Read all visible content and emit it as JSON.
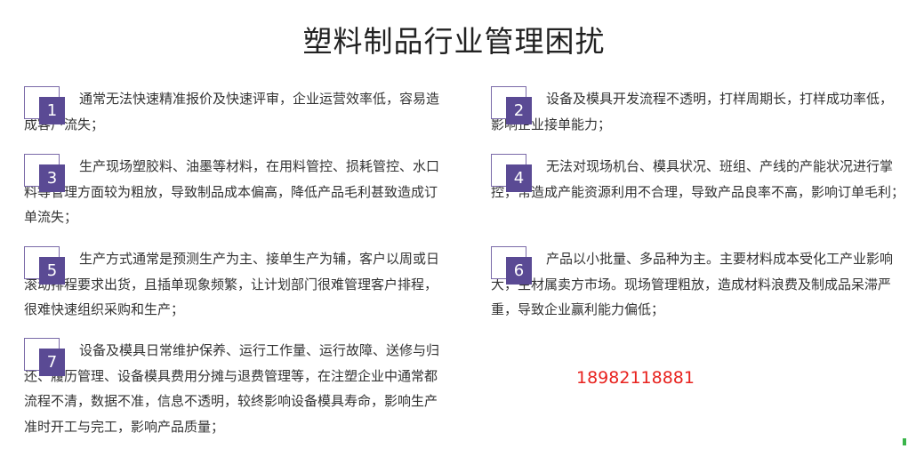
{
  "title": "塑料制品行业管理困扰",
  "items": [
    {
      "num": "1",
      "text": "通常无法快速精准报价及快速评审，企业运营效率低，容易造成客户流失；"
    },
    {
      "num": "2",
      "text": "设备及模具开发流程不透明，打样周期长，打样成功率低，影响企业接单能力；"
    },
    {
      "num": "3",
      "text": "生产现场塑胶料、油墨等材料，在用料管控、损耗管控、水口料等管理方面较为粗放，导致制品成本偏高，降低产品毛利甚致造成订单流失；"
    },
    {
      "num": "4",
      "text": "无法对现场机台、模具状况、班组、产线的产能状况进行掌控，常造成产能资源利用不合理，导致产品良率不高，影响订单毛利；"
    },
    {
      "num": "5",
      "text": "生产方式通常是预测生产为主、接单生产为辅，客户以周或日滚动排程要求出货，且插单现象频繁，让计划部门很难管理客户排程，很难快速组织采购和生产；"
    },
    {
      "num": "6",
      "text": "产品以小批量、多品种为主。主要材料成本受化工产业影响大，主材属卖方市场。现场管理粗放，造成材料浪费及制成品呆滞严重，导致企业赢利能力偏低；"
    },
    {
      "num": "7",
      "text": "设备及模具日常维护保养、运行工作量、运行故障、送修与归还、履历管理、设备模具费用分摊与退费管理等，在注塑企业中通常都流程不清，数据不准，信息不透明，较终影响设备模具寿命，影响生产准时开工与完工，影响产品质量；"
    }
  ],
  "phone": "18982118881",
  "colors": {
    "badge": "#5a4a94",
    "phone": "#e8231f"
  }
}
